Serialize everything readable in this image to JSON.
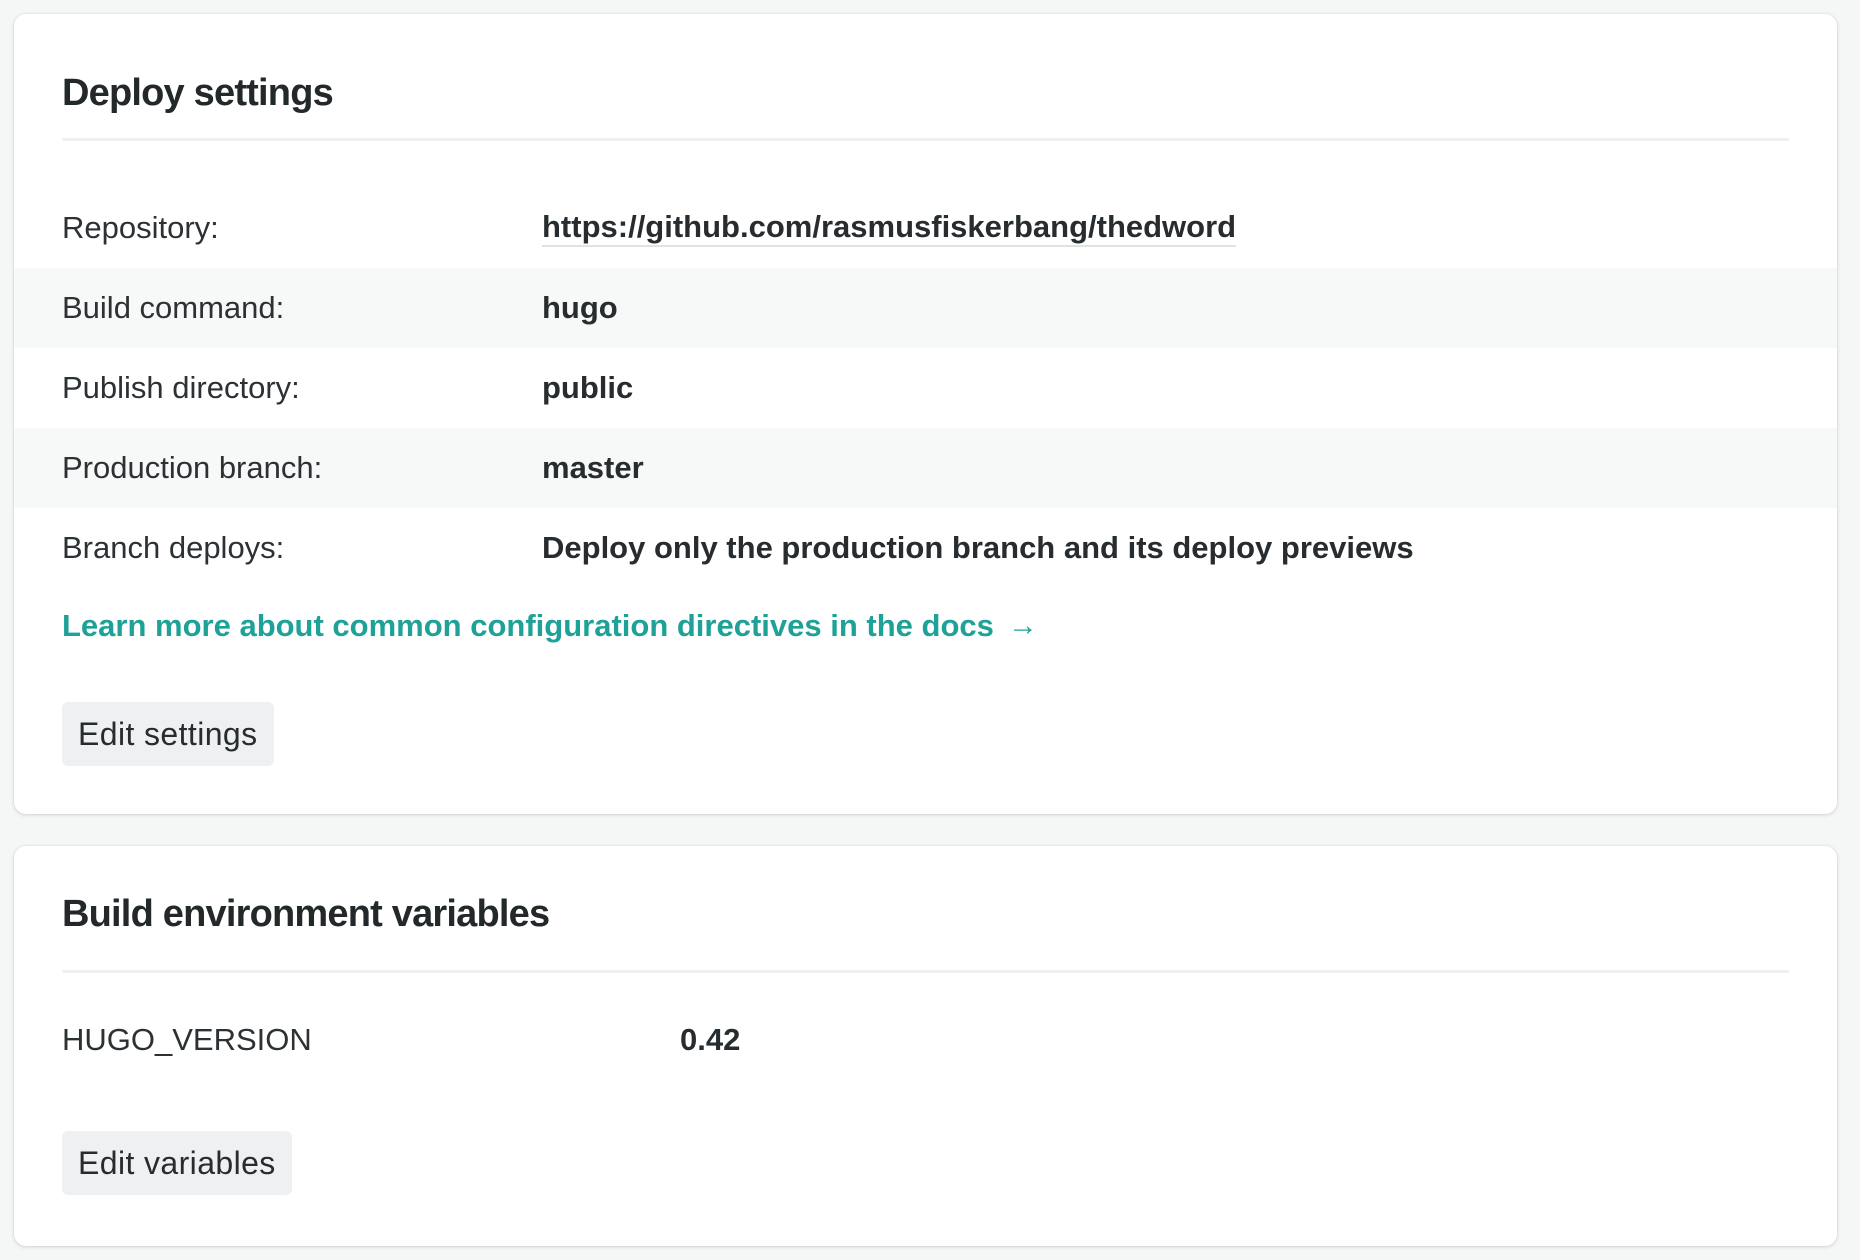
{
  "deploy_settings": {
    "title": "Deploy settings",
    "rows": [
      {
        "label": "Repository:",
        "value": "https://github.com/rasmusfiskerbang/thedword"
      },
      {
        "label": "Build command:",
        "value": "hugo"
      },
      {
        "label": "Publish directory:",
        "value": "public"
      },
      {
        "label": "Production branch:",
        "value": "master"
      },
      {
        "label": "Branch deploys:",
        "value": "Deploy only the production branch and its deploy previews"
      }
    ],
    "docs_link": "Learn more about common configuration directives in the docs",
    "docs_link_arrow": "→",
    "edit_button": "Edit settings"
  },
  "build_env": {
    "title": "Build environment variables",
    "variables": [
      {
        "key": "HUGO_VERSION",
        "value": "0.42"
      }
    ],
    "edit_button": "Edit variables"
  },
  "colors": {
    "accent": "#1ea297",
    "page_background": "#f5f7f7",
    "card_background": "#ffffff",
    "button_background": "#eef0f1"
  }
}
